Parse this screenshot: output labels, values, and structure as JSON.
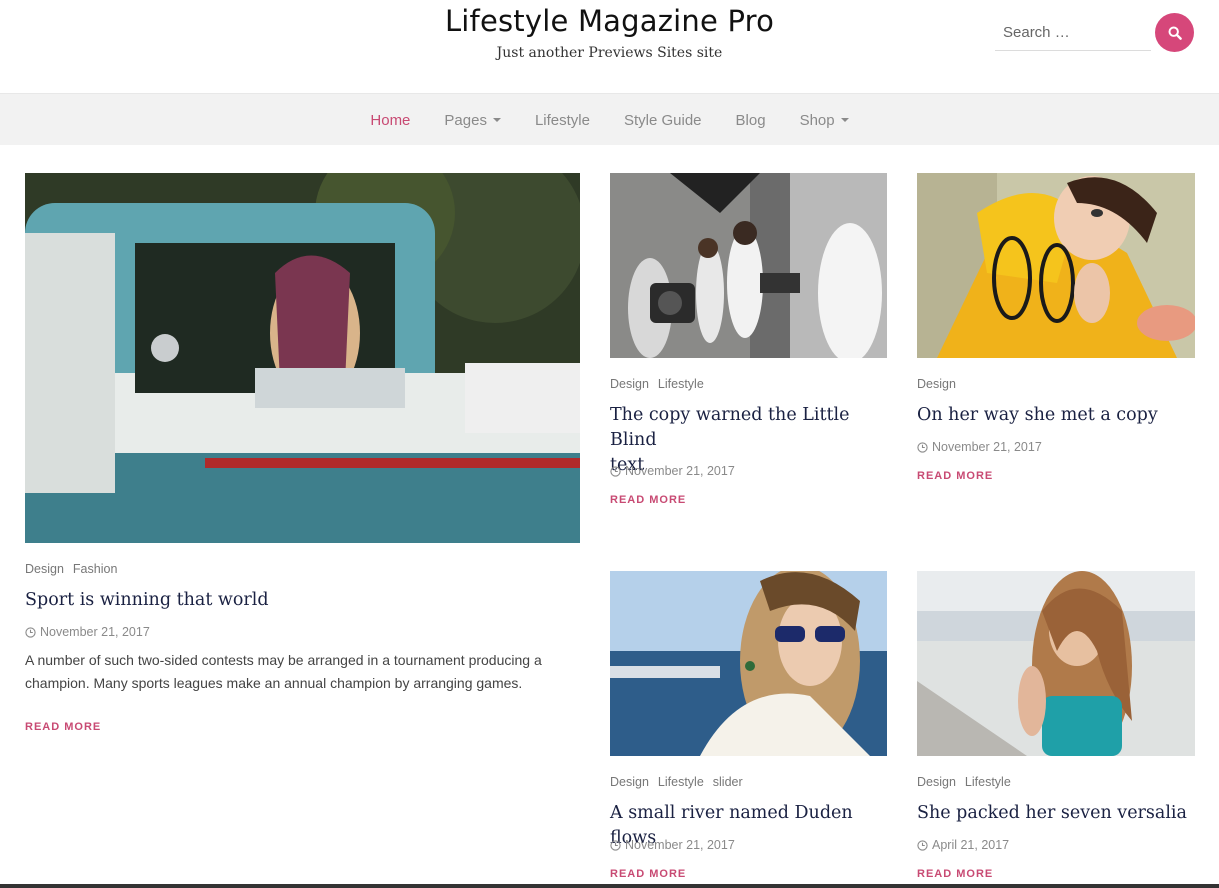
{
  "header": {
    "site_title": "Lifestyle Magazine Pro",
    "tagline": "Just another Previews Sites site",
    "search_placeholder": "Search …",
    "search_icon": "search-icon",
    "accent_color": "#d6477a"
  },
  "nav": {
    "items": [
      {
        "label": "Home",
        "active": true
      },
      {
        "label": "Pages",
        "has_dropdown": true
      },
      {
        "label": "Lifestyle"
      },
      {
        "label": "Style Guide"
      },
      {
        "label": "Blog"
      },
      {
        "label": "Shop",
        "has_dropdown": true
      }
    ]
  },
  "posts": [
    {
      "categories": [
        "Design",
        "Fashion"
      ],
      "title": "Sport is winning that world",
      "date": "November 21, 2017",
      "excerpt_line1": "A number of such two-sided contests may be arranged in a tournament producing a",
      "excerpt_line2": "champion. Many sports leagues make an annual champion by arranging games.",
      "read_more": "READ MORE"
    },
    {
      "categories": [
        "Design",
        "Lifestyle"
      ],
      "title_line1": "The copy warned the Little Blind",
      "title_line2": "text",
      "date": "November 21, 2017",
      "read_more": "READ MORE"
    },
    {
      "categories": [
        "Design"
      ],
      "title": "On her way she met a copy",
      "date": "November 21, 2017",
      "read_more": "READ MORE"
    },
    {
      "categories": [
        "Design",
        "Lifestyle",
        "slider"
      ],
      "title": "A small river named Duden flows",
      "date": "November 21, 2017",
      "read_more": "READ MORE"
    },
    {
      "categories": [
        "Design",
        "Lifestyle"
      ],
      "title": "She packed her seven versalia",
      "date": "April 21, 2017",
      "read_more": "READ MORE"
    }
  ]
}
